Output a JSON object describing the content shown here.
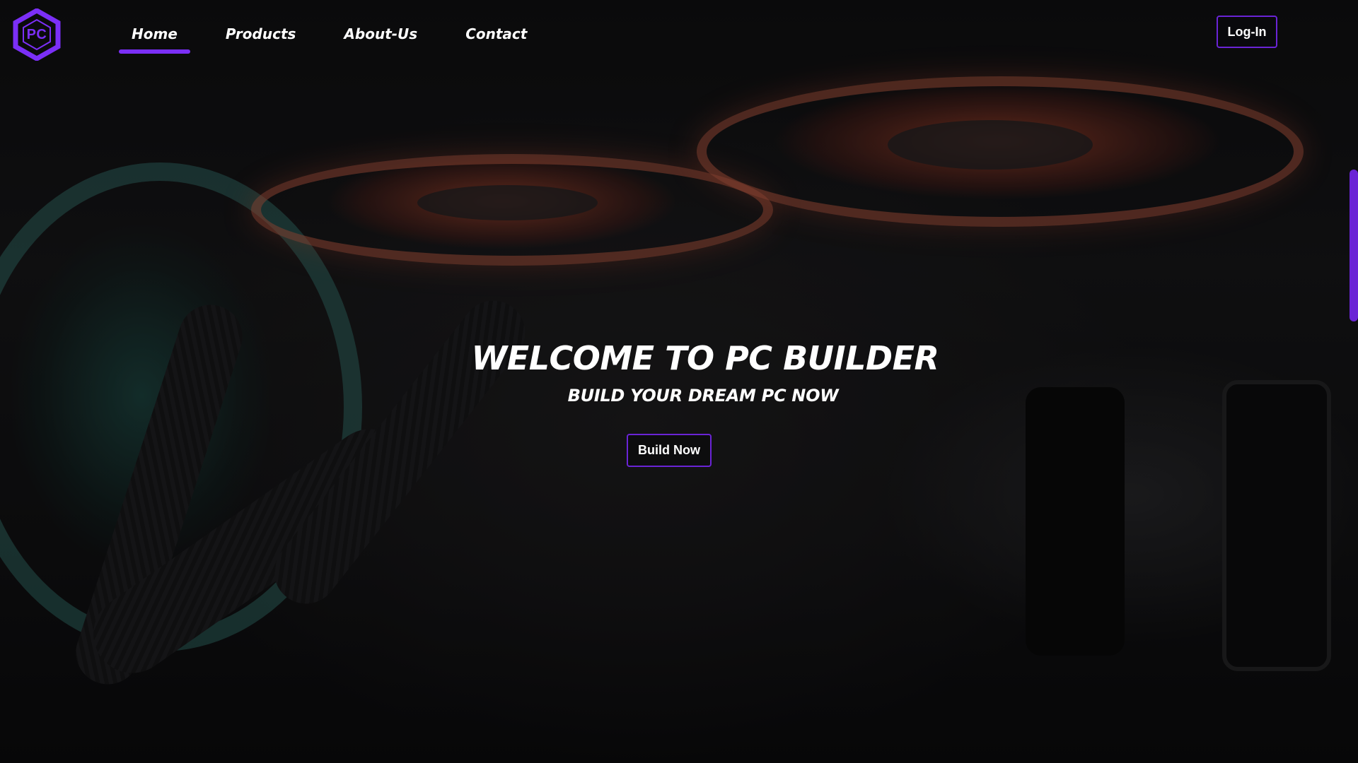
{
  "brand": {
    "logo_text": "PC",
    "accent_color": "#7b2ff7"
  },
  "nav": {
    "items": [
      {
        "label": "Home",
        "active": true
      },
      {
        "label": "Products",
        "active": false
      },
      {
        "label": "About-Us",
        "active": false
      },
      {
        "label": "Contact",
        "active": false
      }
    ],
    "login_label": "Log-In"
  },
  "hero": {
    "title": "WELCOME TO PC BUILDER",
    "subtitle": "BUILD YOUR DREAM PC NOW",
    "cta_label": "Build Now"
  },
  "icons": {
    "logo": "hexagon-logo-icon"
  }
}
